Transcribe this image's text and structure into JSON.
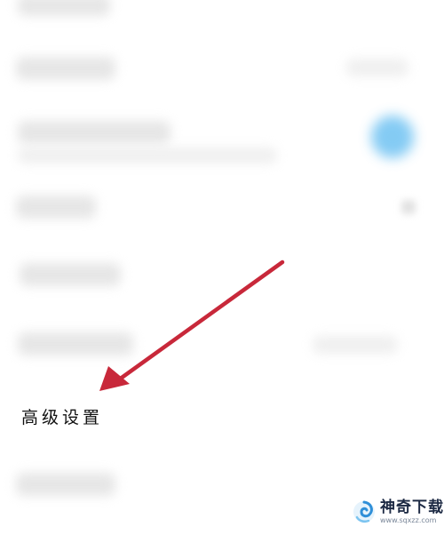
{
  "settings": {
    "advanced_label": "高级设置"
  },
  "annotation": {
    "arrow_color": "#c8283a",
    "arrow_target": "advanced-settings-label"
  },
  "watermark": {
    "title": "神奇下载",
    "url": "www.sqxzz.com",
    "logo_icon": "swirl-logo-icon"
  }
}
